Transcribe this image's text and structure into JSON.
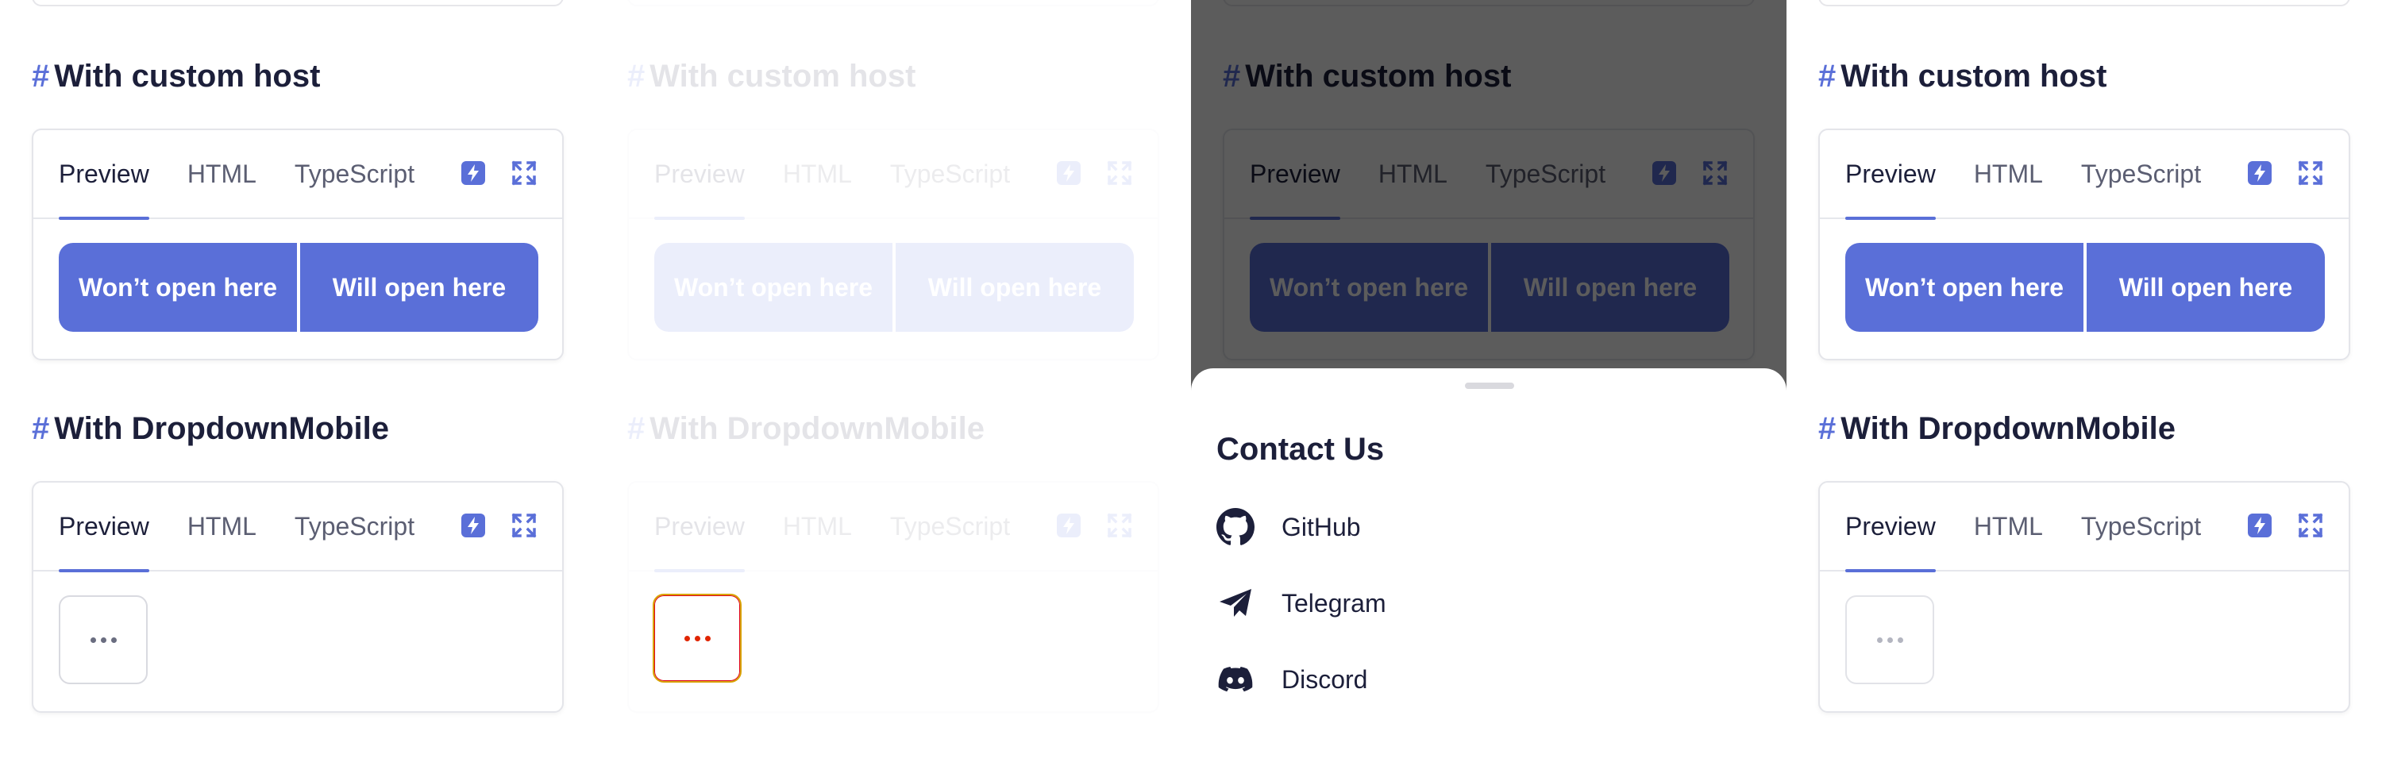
{
  "colors": {
    "accent": "#5a6fd8",
    "text": "#1c1f3a",
    "muted_text": "#5b5e72",
    "overlay": "#000000a3",
    "focus_ring": "#e02500"
  },
  "sections": {
    "custom_host_title": "With custom host",
    "dropdown_title": "With DropdownMobile",
    "hash": "#"
  },
  "tabs": {
    "preview": "Preview",
    "html": "HTML",
    "typescript": "TypeScript"
  },
  "tool_icons": [
    "stackblitz-icon",
    "fullscreen-icon"
  ],
  "buttons": {
    "wont_open": "Won’t open here",
    "will_open": "Will open here"
  },
  "dropdown_button": {
    "icon": "ellipsis-icon"
  },
  "sheet": {
    "title": "Contact Us",
    "items": [
      {
        "label": "GitHub",
        "icon": "github-icon"
      },
      {
        "label": "Telegram",
        "icon": "telegram-icon"
      },
      {
        "label": "Discord",
        "icon": "discord-icon"
      }
    ]
  }
}
